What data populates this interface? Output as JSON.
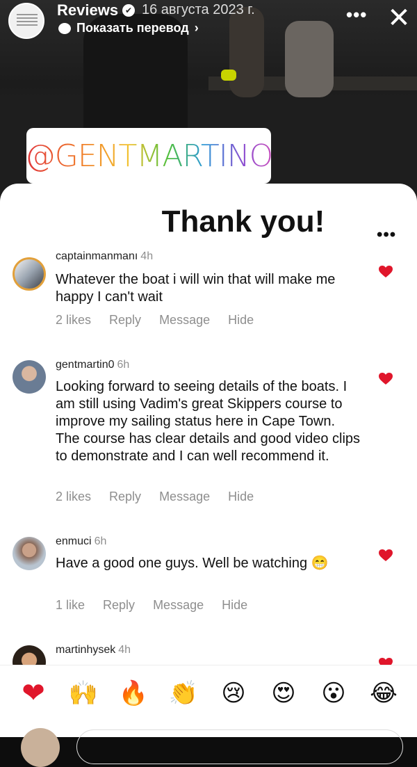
{
  "header": {
    "account_name": "Reviews",
    "date": "16 августа 2023 г.",
    "translate_label": "Показать перевод",
    "translate_chevron": "›",
    "more_glyph": "•••",
    "close_glyph": "✕"
  },
  "sticker": {
    "mention": "@GENTMARTINO"
  },
  "sheet": {
    "title": "Thank you!",
    "more_glyph": "•••"
  },
  "comments": [
    {
      "username": "captainmanmanı",
      "time": "4h",
      "text": "Whatever the boat i will win that will make me happy I can't wait",
      "likes": "2 likes",
      "reply": "Reply",
      "message": "Message",
      "hide": "Hide"
    },
    {
      "username": "gentmartin0",
      "time": "6h",
      "text": "Looking forward to seeing details of the boats. I am still using Vadim's great Skippers course to improve my sailing status here in Cape Town. The course has clear details and good video clips to demonstrate and I can well recommend it.",
      "likes": "2 likes",
      "reply": "Reply",
      "message": "Message",
      "hide": "Hide"
    },
    {
      "username": "enmuci",
      "time": "6h",
      "text": "Have a good one guys. Well be watching 😁",
      "likes": "1 like",
      "reply": "Reply",
      "message": "Message",
      "hide": "Hide"
    },
    {
      "username": "martinhysek",
      "time": "4h"
    }
  ],
  "emoji_bar": {
    "heart": "❤",
    "raised_hands": "🙌",
    "fire": "🔥",
    "clap": "👏",
    "cry": "😢",
    "heart_eyes": "😍",
    "open_mouth": "😮",
    "joy": "😂"
  },
  "colors": {
    "heart": "#e0162b",
    "meta_gray": "#8e8e8e",
    "sheet_bg": "#ffffff"
  }
}
